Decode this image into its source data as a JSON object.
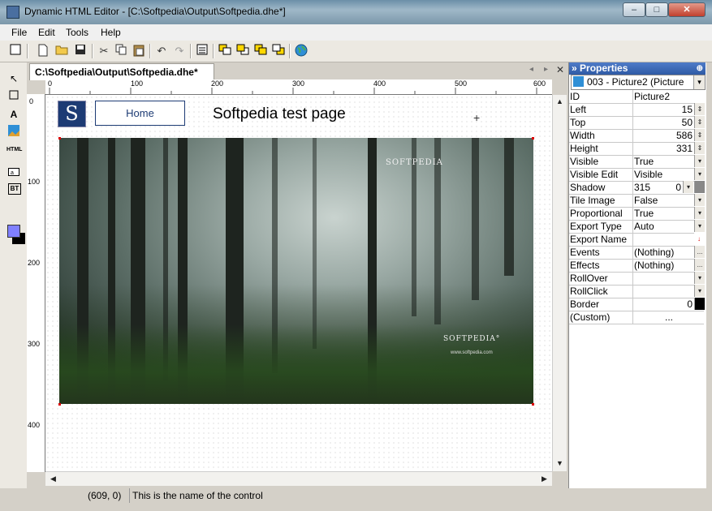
{
  "window": {
    "title": "Dynamic HTML Editor - [C:\\Softpedia\\Output\\Softpedia.dhe*]",
    "minimize_glyph": "–",
    "maximize_glyph": "□",
    "close_glyph": "✕"
  },
  "menu": [
    "File",
    "Edit",
    "Tools",
    "Help"
  ],
  "toolbar": {
    "icons": [
      "new-page-icon",
      "new-file-icon",
      "open-folder-icon",
      "save-icon",
      "cut-icon",
      "copy-icon",
      "paste-icon",
      "undo-icon",
      "redo-icon",
      "properties-icon",
      "bring-front-icon",
      "send-back-icon",
      "bring-forward-icon",
      "send-backward-icon",
      "preview-globe-icon"
    ]
  },
  "palette": {
    "items": [
      "pointer-tool",
      "rectangle-tool",
      "text-tool",
      "image-tool",
      "html-tool",
      "form-field-tool",
      "button-tool"
    ],
    "html_label": "HTML",
    "button_label": "BT",
    "text_label": "A",
    "colors": {
      "foreground": "#8080ff",
      "background": "#000000"
    }
  },
  "document": {
    "tab_title": "C:\\Softpedia\\Output\\Softpedia.dhe*",
    "close_glyph": "✕",
    "nav_left": "◂",
    "nav_right": "▸",
    "hruler_labels": [
      "0",
      "100",
      "200",
      "300",
      "400",
      "500",
      "600"
    ],
    "vruler_labels": [
      "0",
      "100",
      "200",
      "300",
      "400"
    ]
  },
  "page": {
    "logo_letter": "S",
    "home_button": "Home",
    "title": "Softpedia test page",
    "watermark_top": "SOFTPEDIA",
    "watermark_bottom": "SOFTPEDIA°",
    "watermark_url": "www.softpedia.com"
  },
  "properties": {
    "header": "Properties",
    "pin_glyph": "⊕",
    "selected_object": "003 - Picture2 (Picture",
    "rows": [
      {
        "name": "ID",
        "value": "Picture2",
        "btn": ""
      },
      {
        "name": "Left",
        "value": "15",
        "btn": "⇕"
      },
      {
        "name": "Top",
        "value": "50",
        "btn": "⇕"
      },
      {
        "name": "Width",
        "value": "586",
        "btn": "⇕"
      },
      {
        "name": "Height",
        "value": "331",
        "btn": "⇕"
      },
      {
        "name": "Visible",
        "value": "True",
        "btn": "▾"
      },
      {
        "name": "Visible Edit",
        "value": "Visible",
        "btn": "▾"
      },
      {
        "name": "Shadow",
        "value": "315",
        "value2": "0",
        "btn": ""
      },
      {
        "name": "Tile Image",
        "value": "False",
        "btn": "▾"
      },
      {
        "name": "Proportional",
        "value": "True",
        "btn": "▾"
      },
      {
        "name": "Export Type",
        "value": "Auto",
        "btn": "▾"
      },
      {
        "name": "Export Name",
        "value": "",
        "btn": "↓"
      },
      {
        "name": "Events",
        "value": "(Nothing)",
        "btn": "..."
      },
      {
        "name": "Effects",
        "value": "(Nothing)",
        "btn": "..."
      },
      {
        "name": "RollOver",
        "value": "",
        "btn": "▾"
      },
      {
        "name": "RollClick",
        "value": "",
        "btn": "▾"
      },
      {
        "name": "Border",
        "value": "0",
        "btn": ""
      },
      {
        "name": "(Custom)",
        "value": "...",
        "btn": ""
      }
    ]
  },
  "status": {
    "coords": "(609, 0)",
    "message": "This is the name of the control"
  }
}
